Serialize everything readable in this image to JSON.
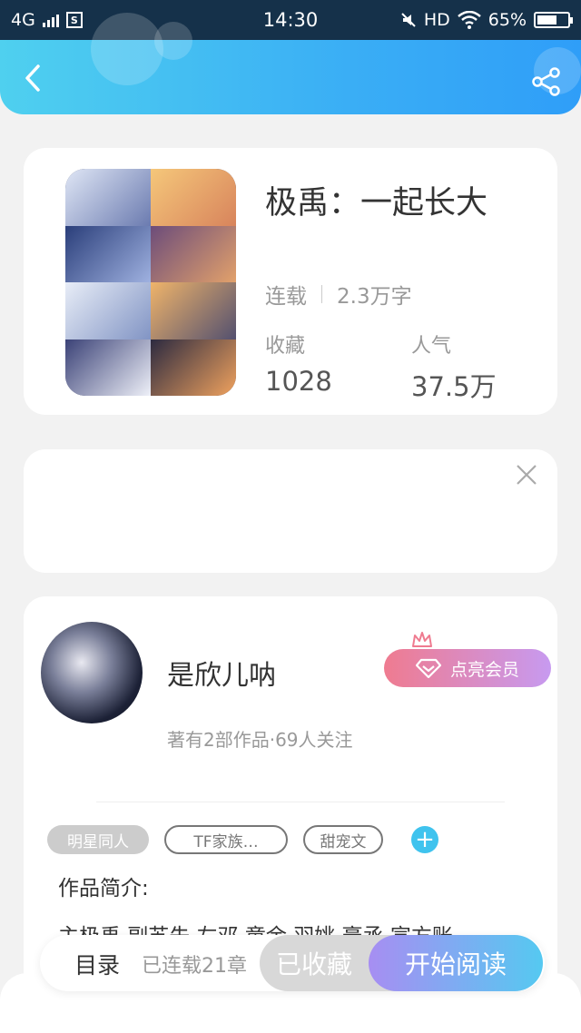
{
  "status_bar": {
    "network": "4G",
    "time": "14:30",
    "hd": "HD",
    "battery": "65%",
    "battery_level": 0.65
  },
  "book": {
    "title": "极禹：一起长大",
    "status": "连载",
    "word_count": "2.3万字",
    "favorites_label": "收藏",
    "favorites_value": "1028",
    "popularity_label": "人气",
    "popularity_value": "37.5万"
  },
  "author": {
    "name": "是欣儿呐",
    "vip_button": "点亮会员",
    "info": "著有2部作品·69人关注"
  },
  "tags": [
    "明星同人",
    "TF家族…",
    "甜宠文"
  ],
  "intro": {
    "label": "作品简介:",
    "text": "主极禹 副苏朱 左邓 童余 羽姚 豪丞 宣方账"
  },
  "bottom": {
    "toc_label": "目录",
    "chapters": "已连载21章",
    "favorited_button": "已收藏",
    "read_button": "开始阅读"
  },
  "colors": {
    "header_start": "#4fd0ef",
    "header_end": "#2f9ef8",
    "accent_blue": "#3fc3ee",
    "vip_start": "#ef7b90",
    "vip_end": "#c79af0"
  }
}
